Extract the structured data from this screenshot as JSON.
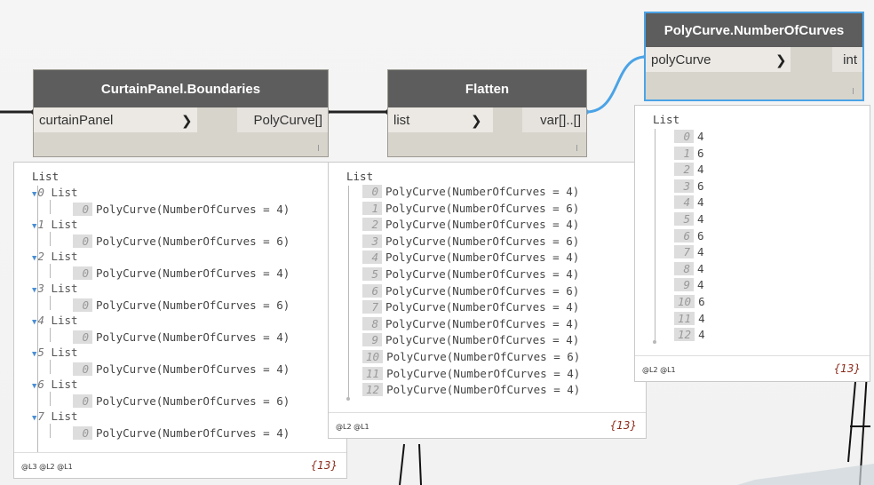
{
  "nodes": {
    "boundaries": {
      "title": "CurtainPanel.Boundaries",
      "input": "curtainPanel",
      "output": "PolyCurve[]"
    },
    "flatten": {
      "title": "Flatten",
      "input": "list",
      "output": "var[]..[]"
    },
    "count": {
      "title": "PolyCurve.NumberOfCurves",
      "input": "polyCurve",
      "output": "int"
    }
  },
  "arrow_glyph": "❯",
  "previews": {
    "boundaries": {
      "title": "List",
      "sublists": [
        {
          "index": "0",
          "label": "List",
          "item_index": "0",
          "value": "PolyCurve(NumberOfCurves = 4)"
        },
        {
          "index": "1",
          "label": "List",
          "item_index": "0",
          "value": "PolyCurve(NumberOfCurves = 6)"
        },
        {
          "index": "2",
          "label": "List",
          "item_index": "0",
          "value": "PolyCurve(NumberOfCurves = 4)"
        },
        {
          "index": "3",
          "label": "List",
          "item_index": "0",
          "value": "PolyCurve(NumberOfCurves = 6)"
        },
        {
          "index": "4",
          "label": "List",
          "item_index": "0",
          "value": "PolyCurve(NumberOfCurves = 4)"
        },
        {
          "index": "5",
          "label": "List",
          "item_index": "0",
          "value": "PolyCurve(NumberOfCurves = 4)"
        },
        {
          "index": "6",
          "label": "List",
          "item_index": "0",
          "value": "PolyCurve(NumberOfCurves = 6)"
        },
        {
          "index": "7",
          "label": "List",
          "item_index": "0",
          "value": "PolyCurve(NumberOfCurves = 4)"
        }
      ],
      "levels": "@L3 @L2 @L1",
      "count": "{13}"
    },
    "flatten": {
      "title": "List",
      "items": [
        {
          "index": "0",
          "value": "PolyCurve(NumberOfCurves = 4)"
        },
        {
          "index": "1",
          "value": "PolyCurve(NumberOfCurves = 6)"
        },
        {
          "index": "2",
          "value": "PolyCurve(NumberOfCurves = 4)"
        },
        {
          "index": "3",
          "value": "PolyCurve(NumberOfCurves = 6)"
        },
        {
          "index": "4",
          "value": "PolyCurve(NumberOfCurves = 4)"
        },
        {
          "index": "5",
          "value": "PolyCurve(NumberOfCurves = 4)"
        },
        {
          "index": "6",
          "value": "PolyCurve(NumberOfCurves = 6)"
        },
        {
          "index": "7",
          "value": "PolyCurve(NumberOfCurves = 4)"
        },
        {
          "index": "8",
          "value": "PolyCurve(NumberOfCurves = 4)"
        },
        {
          "index": "9",
          "value": "PolyCurve(NumberOfCurves = 4)"
        },
        {
          "index": "10",
          "value": "PolyCurve(NumberOfCurves = 6)"
        },
        {
          "index": "11",
          "value": "PolyCurve(NumberOfCurves = 4)"
        },
        {
          "index": "12",
          "value": "PolyCurve(NumberOfCurves = 4)"
        }
      ],
      "levels": "@L2 @L1",
      "count": "{13}"
    },
    "count": {
      "title": "List",
      "items": [
        {
          "index": "0",
          "value": "4"
        },
        {
          "index": "1",
          "value": "6"
        },
        {
          "index": "2",
          "value": "4"
        },
        {
          "index": "3",
          "value": "6"
        },
        {
          "index": "4",
          "value": "4"
        },
        {
          "index": "5",
          "value": "4"
        },
        {
          "index": "6",
          "value": "6"
        },
        {
          "index": "7",
          "value": "4"
        },
        {
          "index": "8",
          "value": "4"
        },
        {
          "index": "9",
          "value": "4"
        },
        {
          "index": "10",
          "value": "6"
        },
        {
          "index": "11",
          "value": "4"
        },
        {
          "index": "12",
          "value": "4"
        }
      ],
      "levels": "@L2 @L1",
      "count": "{13}"
    }
  },
  "colors": {
    "selected_border": "#4ba3e6",
    "wire_selected": "#4ba3e6",
    "wire": "#222222",
    "count_text": "#8b2a1a"
  }
}
